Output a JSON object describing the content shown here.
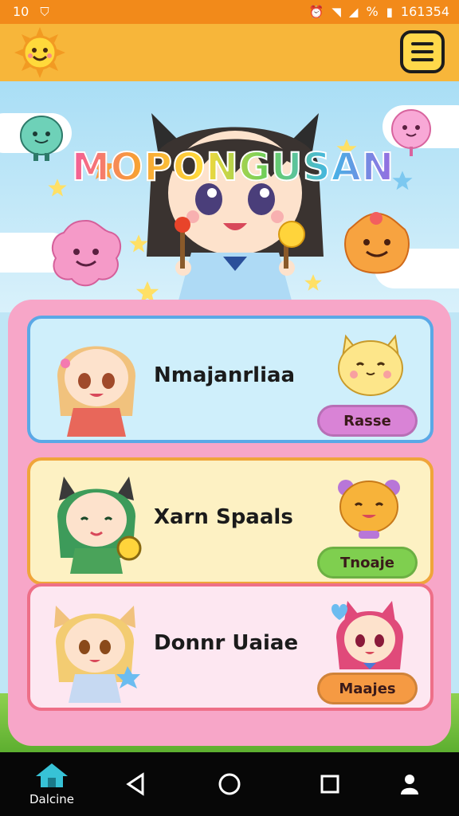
{
  "status": {
    "time": "10",
    "battery_text": "%",
    "clock": "161354"
  },
  "app": {
    "title": "MOPONGUSAN"
  },
  "cards": [
    {
      "name": "Nmajanrliaa",
      "button": "Rasse",
      "button_color": "#d983d6",
      "bg": "#cfeffb",
      "border": "#5aa8e6"
    },
    {
      "name": "Xarn Spaals",
      "button": "Tnoaje",
      "button_color": "#7fcf4f",
      "bg": "#fdf1c3",
      "border": "#f0a53a"
    },
    {
      "name": "Donnr Uaiae",
      "button": "Maajes",
      "button_color": "#f59a43",
      "bg": "#fde7f1",
      "border": "#ee6f88"
    }
  ],
  "navbar": {
    "home_label": "Dalcine"
  },
  "colors": {
    "statusbar": "#f28a1a",
    "header": "#f7b63a",
    "panel": "#f7a6c8",
    "navbar": "#070707"
  },
  "icons": [
    "sun-icon",
    "menu-icon",
    "home-icon",
    "back-icon",
    "circle-home-icon",
    "recents-icon",
    "person-icon"
  ]
}
